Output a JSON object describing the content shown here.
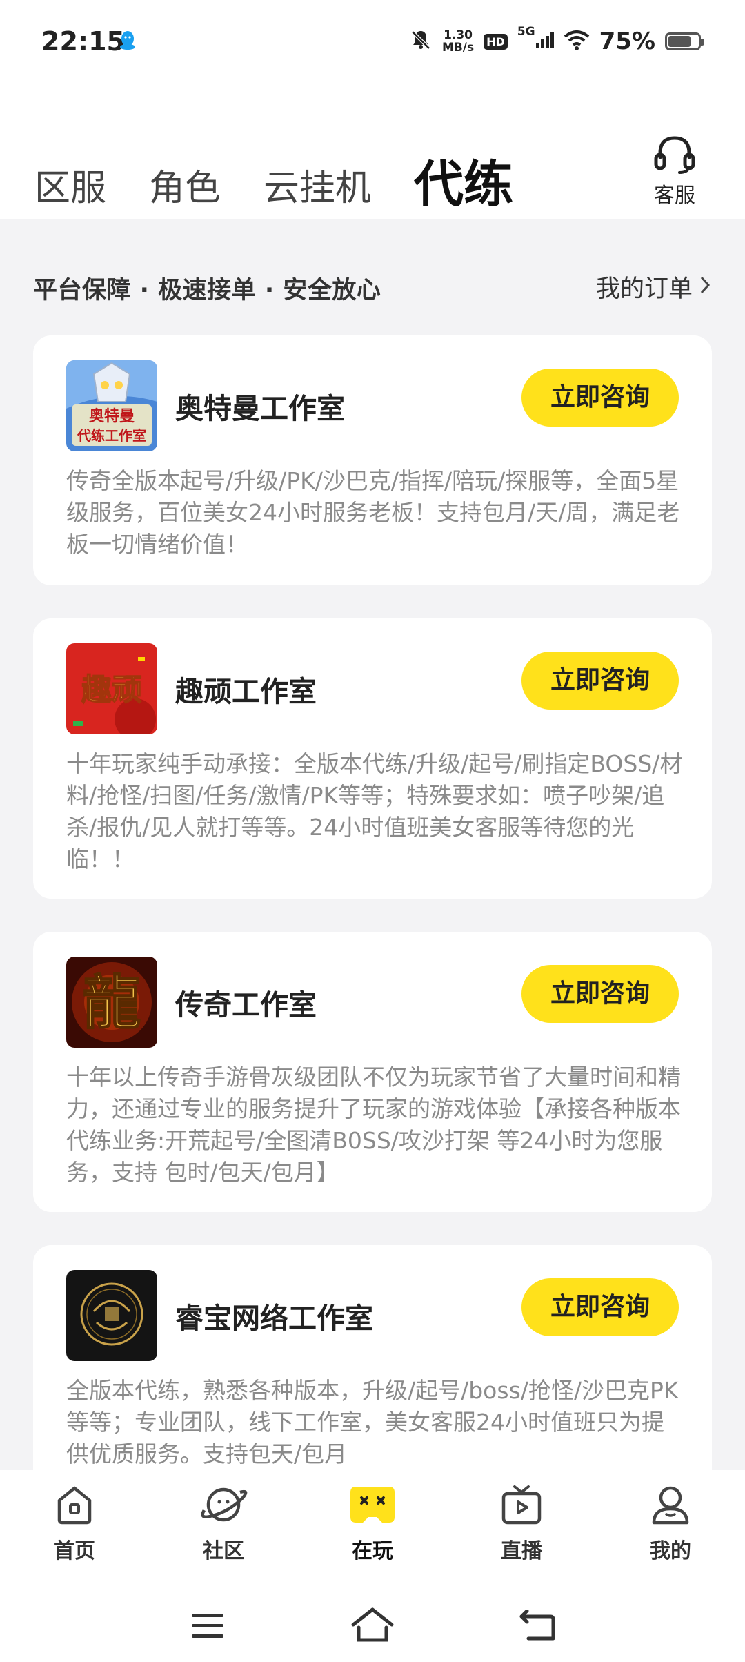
{
  "status_bar": {
    "time": "22:15",
    "net_speed_value": "1.30",
    "net_speed_unit": "MB/s",
    "hd_label": "HD",
    "network_label": "5G",
    "battery_percent_text": "75%",
    "battery_level": 0.75
  },
  "tabs": [
    {
      "label": "区服",
      "active": false
    },
    {
      "label": "角色",
      "active": false
    },
    {
      "label": "云挂机",
      "active": false
    },
    {
      "label": "代练",
      "active": true
    }
  ],
  "customer_service": {
    "label": "客服",
    "icon": "headset-icon"
  },
  "promo": {
    "text": "平台保障 · 极速接单 · 安全放心"
  },
  "my_orders": {
    "label": "我的订单"
  },
  "cards": [
    {
      "name": "奥特曼工作室",
      "button": "立即咨询",
      "description": "传奇全版本起号/升级/PK/沙巴克/指挥/陪玩/探服等，全面5星级服务，百位美女24小时服务老板！支持包月/天/周，满足老板一切情绪价值！",
      "logo_text_line1": "奥特曼",
      "logo_text_line2": "代练工作室"
    },
    {
      "name": "趣顽工作室",
      "button": "立即咨询",
      "description": "十年玩家纯手动承接：全版本代练/升级/起号/刷指定BOSS/材料/抢怪/扫图/任务/激情/PK等等；特殊要求如：喷子吵架/追杀/报仇/见人就打等等。24小时值班美女客服等待您的光临！！",
      "logo_text": "趣顽"
    },
    {
      "name": "传奇工作室",
      "button": "立即咨询",
      "description": "十年以上传奇手游骨灰级团队不仅为玩家节省了大量时间和精力，还通过专业的服务提升了玩家的游戏体验【承接各种版本代练业务:开荒起号/全图清B0SS/攻沙打架 等24小时为您服务，支持 包时/包天/包月】",
      "logo_text": "龍"
    },
    {
      "name": "睿宝网络工作室",
      "button": "立即咨询",
      "description": "全版本代练，熟悉各种版本，升级/起号/boss/抢怪/沙巴克PK等等；专业团队，线下工作室，美女客服24小时值班只为提供优质服务。支持包天/包月"
    }
  ],
  "bottom_nav": [
    {
      "label": "首页",
      "icon": "home-icon",
      "active": false
    },
    {
      "label": "社区",
      "icon": "planet-icon",
      "active": false
    },
    {
      "label": "在玩",
      "icon": "gamepad-icon",
      "active": true
    },
    {
      "label": "直播",
      "icon": "tv-icon",
      "active": false
    },
    {
      "label": "我的",
      "icon": "profile-icon",
      "active": false
    }
  ],
  "colors": {
    "accent": "#ffe11b",
    "background": "#f3f3f5",
    "card": "#ffffff",
    "description_text": "#8a8a8a"
  }
}
